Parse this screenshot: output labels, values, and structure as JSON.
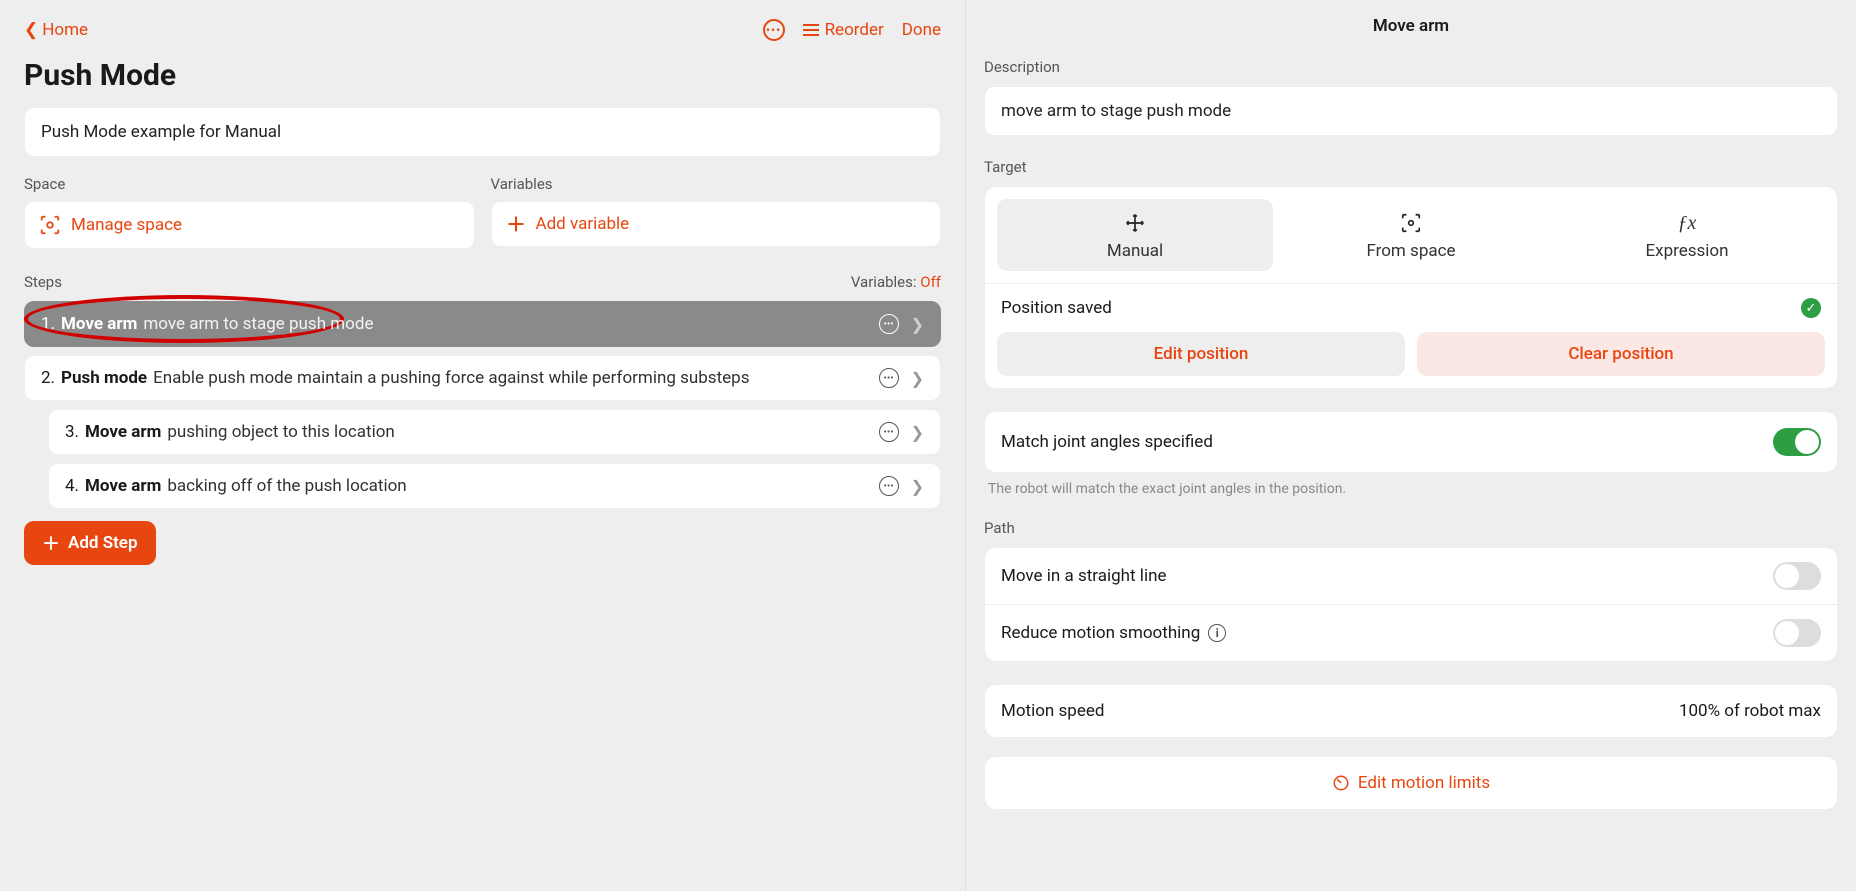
{
  "header": {
    "home": "Home",
    "reorder": "Reorder",
    "done": "Done"
  },
  "title": "Push Mode",
  "description_value": "Push Mode example for Manual",
  "space_label": "Space",
  "variables_label": "Variables",
  "manage_space": "Manage space",
  "add_variable": "Add variable",
  "steps_label": "Steps",
  "variables_word": "Variables:",
  "variables_state": "Off",
  "steps": [
    {
      "num": "1.",
      "name": "Move arm",
      "desc": "move arm to stage push mode"
    },
    {
      "num": "2.",
      "name": "Push mode",
      "desc": "Enable push mode maintain a pushing force against while performing substeps"
    },
    {
      "num": "3.",
      "name": "Move arm",
      "desc": "pushing object to this location"
    },
    {
      "num": "4.",
      "name": "Move arm",
      "desc": "backing off of the push location"
    }
  ],
  "add_step": "Add Step",
  "right": {
    "title": "Move arm",
    "description_label": "Description",
    "description_value": "move arm to stage push mode",
    "target_label": "Target",
    "tabs": {
      "manual": "Manual",
      "from_space": "From space",
      "expression": "Expression"
    },
    "position_saved": "Position saved",
    "edit_position": "Edit position",
    "clear_position": "Clear position",
    "match_joint": "Match joint angles specified",
    "match_hint": "The robot will match the exact joint angles in the position.",
    "path_label": "Path",
    "straight_line": "Move in a straight line",
    "reduce_smoothing": "Reduce motion smoothing",
    "motion_speed_label": "Motion speed",
    "motion_speed_value": "100% of robot max",
    "edit_limits": "Edit motion limits"
  }
}
